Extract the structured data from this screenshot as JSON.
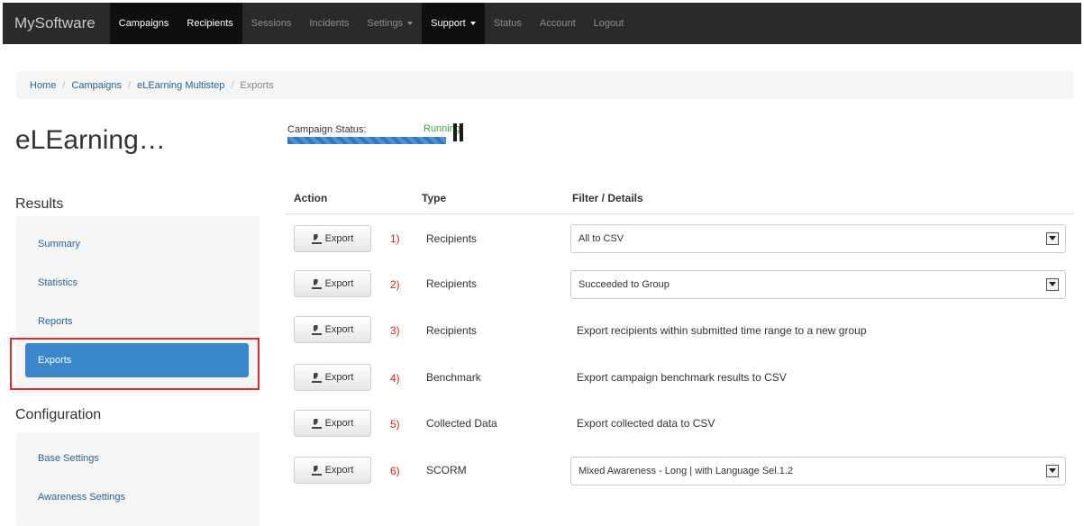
{
  "navbar": {
    "brand": "MySoftware",
    "items": [
      {
        "label": "Campaigns",
        "active": true
      },
      {
        "label": "Recipients",
        "active": true
      },
      {
        "label": "Sessions",
        "active": false
      },
      {
        "label": "Incidents",
        "active": false
      },
      {
        "label": "Settings",
        "active": false,
        "dropdown": true
      },
      {
        "label": "Support",
        "active": true,
        "dropdown": true
      },
      {
        "label": "Status",
        "active": false
      },
      {
        "label": "Account",
        "active": false
      },
      {
        "label": "Logout",
        "active": false
      }
    ]
  },
  "breadcrumb": [
    {
      "label": "Home"
    },
    {
      "label": "Campaigns"
    },
    {
      "label": "eLEarning Multistep"
    },
    {
      "label": "Exports"
    }
  ],
  "page_title": "eLEarning…",
  "campaign_status": {
    "label": "Campaign Status:",
    "value": "Running",
    "colors": {
      "value": "#3fa53f",
      "bar": "#2f78c4"
    },
    "pause_icon": "pause-icon"
  },
  "sidebar": {
    "results_heading": "Results",
    "results_items": [
      {
        "label": "Summary"
      },
      {
        "label": "Statistics"
      },
      {
        "label": "Reports"
      },
      {
        "label": "Exports",
        "active": true
      }
    ],
    "configuration_heading": "Configuration",
    "configuration_items": [
      {
        "label": "Base Settings"
      },
      {
        "label": "Awareness Settings"
      }
    ]
  },
  "table": {
    "headers": {
      "action": "Action",
      "type": "Type",
      "filter": "Filter / Details"
    },
    "export_label": "Export",
    "rows": [
      {
        "num": "1)",
        "type": "Recipients",
        "detail": "All to CSV",
        "is_select": true
      },
      {
        "num": "2)",
        "type": "Recipients",
        "detail": "Succeeded to Group",
        "is_select": true
      },
      {
        "num": "3)",
        "type": "Recipients",
        "detail": "Export recipients within submitted time range to a new group",
        "is_select": false
      },
      {
        "num": "4)",
        "type": "Benchmark",
        "detail": "Export campaign benchmark results to CSV",
        "is_select": false
      },
      {
        "num": "5)",
        "type": "Collected Data",
        "detail": "Export collected data to CSV",
        "is_select": false
      },
      {
        "num": "6)",
        "type": "SCORM",
        "detail": "Mixed Awareness - Long | with Language Sel.1.2",
        "is_select": true
      }
    ]
  },
  "colors": {
    "navbar": "#2a2a2a",
    "link": "#2a6496",
    "active_sidebar": "#3a87cc",
    "row_number": "#e02020"
  }
}
